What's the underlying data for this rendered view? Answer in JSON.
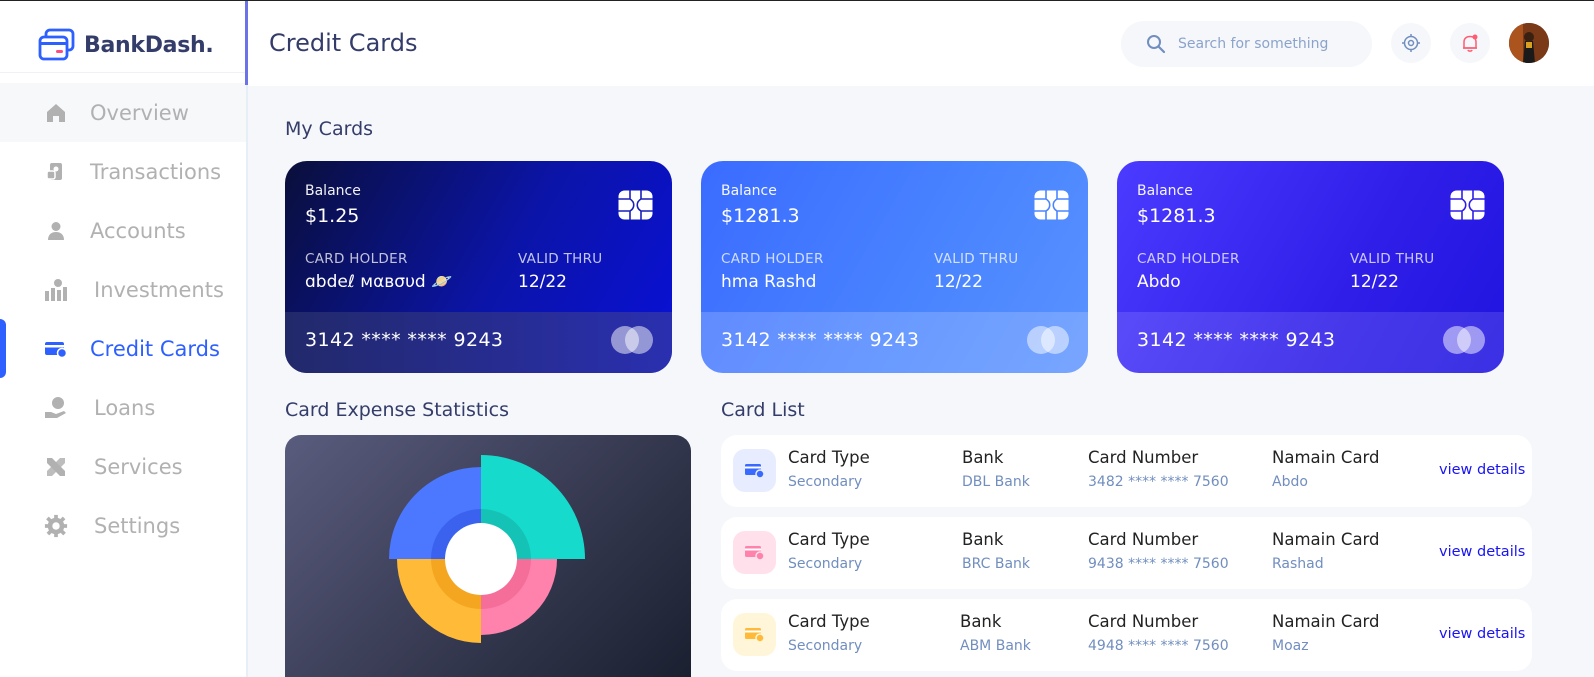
{
  "app": {
    "name": "BankDash."
  },
  "header": {
    "title": "Credit Cards",
    "search_placeholder": "Search for something"
  },
  "sidebar": {
    "items": [
      {
        "label": "Overview",
        "icon": "home-icon"
      },
      {
        "label": "Transactions",
        "icon": "transfer-icon"
      },
      {
        "label": "Accounts",
        "icon": "user-icon"
      },
      {
        "label": "Investments",
        "icon": "investment-icon"
      },
      {
        "label": "Credit Cards",
        "icon": "credit-card-icon",
        "active": true
      },
      {
        "label": "Loans",
        "icon": "loan-icon"
      },
      {
        "label": "Services",
        "icon": "services-icon"
      },
      {
        "label": "Settings",
        "icon": "settings-icon"
      }
    ]
  },
  "my_cards": {
    "title": "My Cards",
    "cards": [
      {
        "balance_label": "Balance",
        "balance": "$1.25",
        "holder_label": "CARD HOLDER",
        "holder": "ɑbdeℓ мαвσυd 🪐",
        "valid_label": "VALID THRU",
        "valid": "12/22",
        "number": "3142 **** **** 9243"
      },
      {
        "balance_label": "Balance",
        "balance": "$1281.3",
        "holder_label": "CARD HOLDER",
        "holder": "hma Rashd",
        "valid_label": "VALID THRU",
        "valid": "12/22",
        "number": "3142 **** **** 9243"
      },
      {
        "balance_label": "Balance",
        "balance": "$1281.3",
        "holder_label": "CARD HOLDER",
        "holder": "Abdo",
        "valid_label": "VALID THRU",
        "valid": "12/22",
        "number": "3142 **** **** 9243"
      }
    ]
  },
  "stats": {
    "title": "Card Expense Statistics"
  },
  "card_list": {
    "title": "Card List",
    "rows": [
      {
        "type_label": "Card Type",
        "type": "Secondary",
        "bank_label": "Bank",
        "bank": "DBL Bank",
        "number_label": "Card Number",
        "number": "3482 **** **** 7560",
        "name_label": "Namain Card",
        "name": "Abdo",
        "link": "view details",
        "icon_color": "#396AFF",
        "icon_bg": "#E7EDFF"
      },
      {
        "type_label": "Card Type",
        "type": "Secondary",
        "bank_label": "Bank",
        "bank": "BRC Bank",
        "number_label": "Card Number",
        "number": "9438 **** **** 7560",
        "name_label": "Namain Card",
        "name": "Rashad",
        "link": "view details",
        "icon_color": "#FF82AC",
        "icon_bg": "#FFE0EB"
      },
      {
        "type_label": "Card Type",
        "type": "Secondary",
        "bank_label": "Bank",
        "bank": "ABM Bank",
        "number_label": "Card Number",
        "number": "4948 **** **** 7560",
        "name_label": "Namain Card",
        "name": "Moaz",
        "link": "view details",
        "icon_color": "#FFBB38",
        "icon_bg": "#FFF5D9"
      }
    ]
  }
}
